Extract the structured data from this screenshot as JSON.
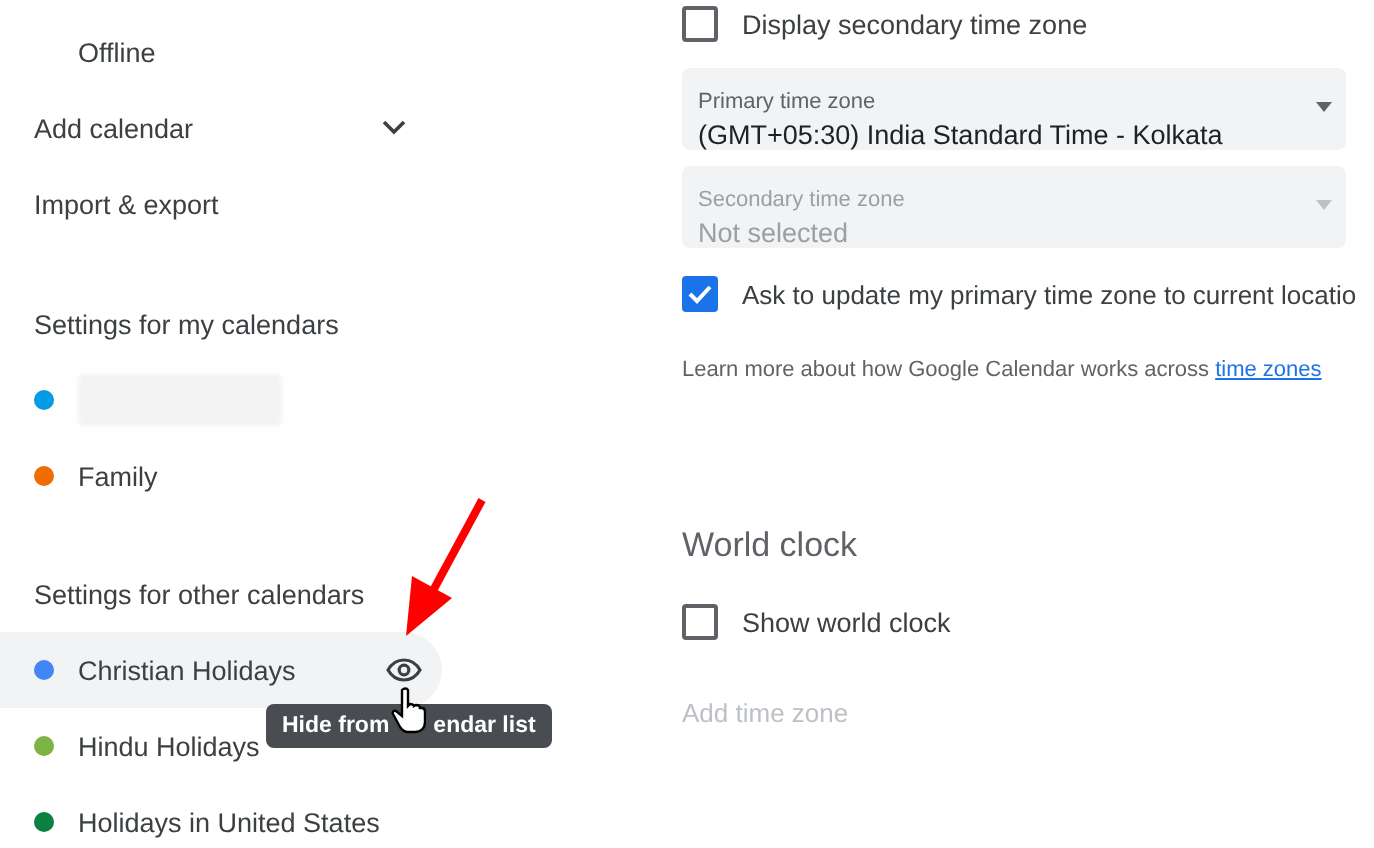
{
  "sidebar": {
    "items": [
      {
        "label": "Offline",
        "kind": "sub"
      },
      {
        "label": "Add calendar",
        "kind": "expandable",
        "expanded": false
      },
      {
        "label": "Import & export",
        "kind": "plain"
      }
    ],
    "sections": [
      {
        "heading": "Settings for my calendars",
        "calendars": [
          {
            "kind": "blurred",
            "color": "#039be5",
            "hovered": false
          },
          {
            "kind": "named",
            "label": "Family",
            "color": "#ef6c00",
            "hovered": false
          }
        ]
      },
      {
        "heading": "Settings for other calendars",
        "calendars": [
          {
            "kind": "named",
            "label": "Christian Holidays",
            "color": "#4285f4",
            "hovered": true,
            "tooltip": [
              "Hide from",
              "endar list"
            ]
          },
          {
            "kind": "named",
            "label": "Hindu Holidays",
            "color": "#7cb342",
            "hovered": false
          },
          {
            "kind": "named",
            "label": "Holidays in United States",
            "color": "#0b8043",
            "hovered": false
          }
        ]
      }
    ]
  },
  "time_zone": {
    "display_secondary": {
      "label": "Display secondary time zone",
      "checked": false
    },
    "primary": {
      "label": "Primary time zone",
      "value": "(GMT+05:30) India Standard Time - Kolkata",
      "disabled": false
    },
    "secondary": {
      "label": "Secondary time zone",
      "value": "Not selected",
      "disabled": true
    },
    "ask_update": {
      "label": "Ask to update my primary time zone to current locatio",
      "checked": true
    },
    "learn_more": {
      "text": "Learn more about how Google Calendar works across ",
      "link": "time zones"
    }
  },
  "world_clock": {
    "title": "World clock",
    "show": {
      "label": "Show world clock",
      "checked": false
    },
    "add_time_zone": {
      "label": "Add time zone",
      "disabled": true
    }
  }
}
